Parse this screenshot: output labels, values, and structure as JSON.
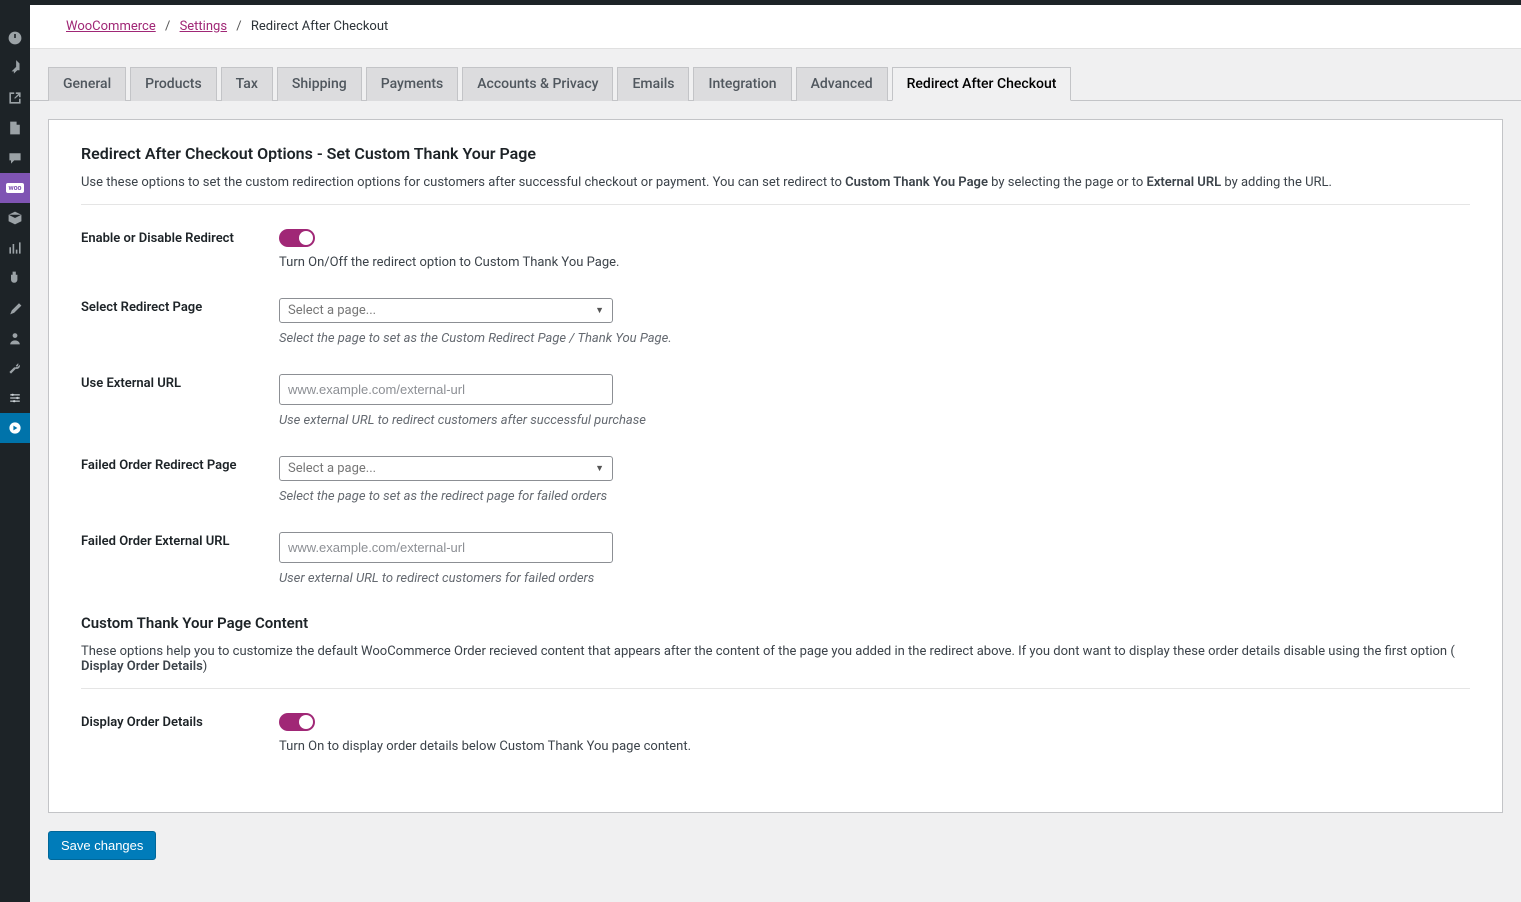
{
  "breadcrumb": {
    "link1": "WooCommerce",
    "link2": "Settings",
    "current": "Redirect After Checkout"
  },
  "tabs": {
    "general": "General",
    "products": "Products",
    "tax": "Tax",
    "shipping": "Shipping",
    "payments": "Payments",
    "accounts": "Accounts & Privacy",
    "emails": "Emails",
    "integration": "Integration",
    "advanced": "Advanced",
    "redirect": "Redirect After Checkout"
  },
  "section1": {
    "title": "Redirect After Checkout Options - Set Custom Thank Your Page",
    "desc_1": "Use these options to set the custom redirection options for customers after successful checkout or payment. You can set redirect to ",
    "desc_bold_1": "Custom Thank You Page",
    "desc_2": " by selecting the page or to ",
    "desc_bold_2": "External URL",
    "desc_3": " by adding the URL."
  },
  "fields": {
    "enable": {
      "label": "Enable or Disable Redirect",
      "help": "Turn On/Off the redirect option to Custom Thank You Page."
    },
    "select_page": {
      "label": "Select Redirect Page",
      "placeholder": "Select a page...",
      "help": "Select the page to set as the Custom Redirect Page / Thank You Page."
    },
    "external_url": {
      "label": "Use External URL",
      "placeholder": "www.example.com/external-url",
      "help": "Use external URL to redirect customers after successful purchase"
    },
    "fail_page": {
      "label": "Failed Order Redirect Page",
      "placeholder": "Select a page...",
      "help": "Select the page to set as the redirect page for failed orders"
    },
    "fail_url": {
      "label": "Failed Order External URL",
      "placeholder": "www.example.com/external-url",
      "help": "User external URL to redirect customers for failed orders"
    }
  },
  "section2": {
    "title": "Custom Thank Your Page Content",
    "desc_1": "These options help you to customize the default WooCommerce Order recieved content that appears after the content of the page you added in the redirect above. If you dont want to display these order details disable using the first option ( ",
    "desc_bold": "Display Order Details",
    "desc_2": ")"
  },
  "fields2": {
    "display": {
      "label": "Display Order Details",
      "help": "Turn On to display order details below Custom Thank You page content."
    }
  },
  "buttons": {
    "save": "Save changes"
  },
  "woo_badge": "woo"
}
